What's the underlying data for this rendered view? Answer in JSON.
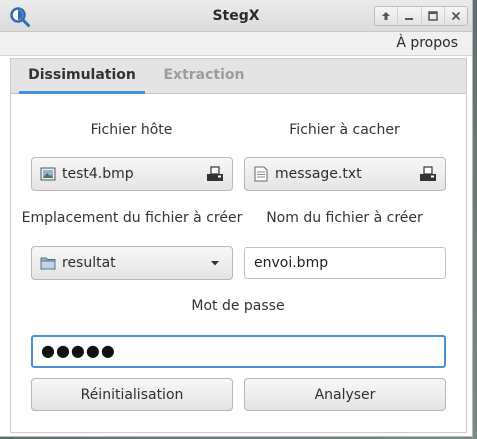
{
  "window": {
    "title": "StegX"
  },
  "menubar": {
    "about_label": "À propos"
  },
  "tabs": [
    {
      "label": "Dissimulation",
      "active": true
    },
    {
      "label": "Extraction",
      "active": false
    }
  ],
  "form": {
    "host_file_label": "Fichier hôte",
    "host_file_value": "test4.bmp",
    "hidden_file_label": "Fichier à cacher",
    "hidden_file_value": "message.txt",
    "location_label": "Emplacement du fichier à créer",
    "location_value": "resultat",
    "output_name_label": "Nom du fichier à créer",
    "output_name_value": "envoi.bmp",
    "password_label": "Mot de passe",
    "password_value": "●●●●●"
  },
  "actions": {
    "reset_label": "Réinitialisation",
    "analyze_label": "Analyser"
  },
  "colors": {
    "accent": "#4a90d9",
    "inactive_tab": "#9d9d9d"
  }
}
